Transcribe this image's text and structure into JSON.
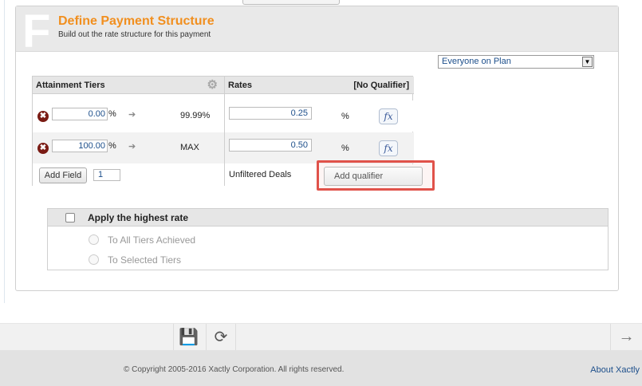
{
  "header": {
    "logo_letter": "F",
    "title": "Define Payment Structure",
    "subtitle": "Build out the rate structure for this payment"
  },
  "plan_selector": {
    "selected": "Everyone on Plan"
  },
  "tiers_table": {
    "left_header": "Attainment Tiers",
    "right_header": "Rates",
    "qualifier_header": "[No Qualifier]",
    "rows": [
      {
        "from": "0.00",
        "unit": "%",
        "to": "99.99%",
        "rate": "0.25",
        "rate_unit": "%",
        "fx": "fx"
      },
      {
        "from": "100.00",
        "unit": "%",
        "to": "MAX",
        "rate": "0.50",
        "rate_unit": "%",
        "fx": "fx"
      }
    ],
    "add_field_label": "Add Field",
    "field_count": "1",
    "unfiltered_label": "Unfiltered Deals",
    "add_qualifier_label": "Add qualifier"
  },
  "highest_rate": {
    "label": "Apply the highest rate",
    "options": [
      "To All Tiers Achieved",
      "To Selected Tiers"
    ]
  },
  "toolbar": {
    "save_icon": "save-icon",
    "refresh_icon": "refresh-icon",
    "next_icon": "arrow-right-icon"
  },
  "footer": {
    "copyright": "© Copyright 2005-2016 Xactly Corporation. All rights reserved.",
    "about": "About Xactly"
  },
  "colors": {
    "title": "#f18f1f",
    "link": "#1d4f8b",
    "highlight": "#e0524a"
  }
}
